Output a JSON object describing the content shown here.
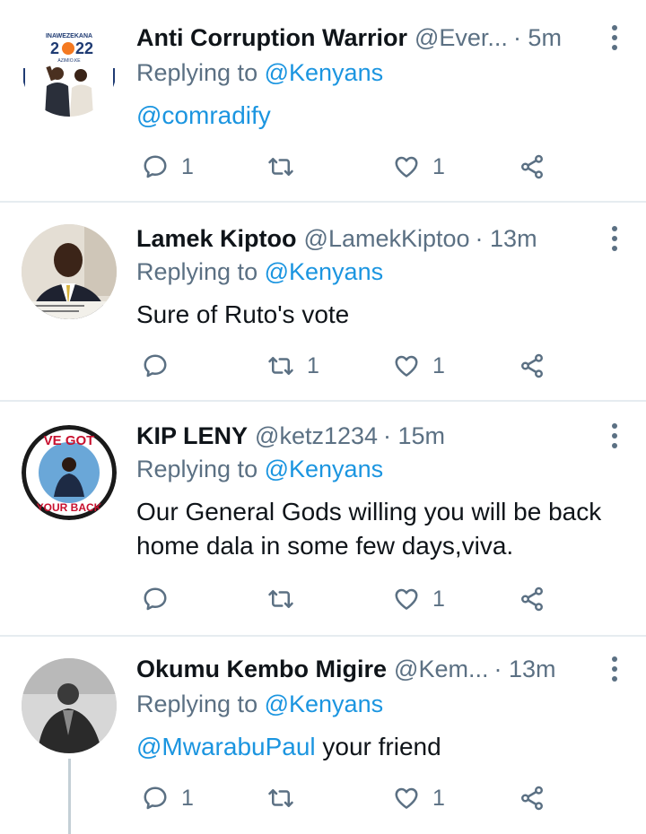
{
  "tweets": [
    {
      "name": "Anti Corruption Warrior",
      "handle": "@Ever...",
      "time": "· 5m",
      "replying_label": "Replying to",
      "replying_to": "@Kenyans",
      "mention": "@comradify",
      "text": "",
      "replies": "1",
      "retweets": "",
      "likes": "1",
      "avatar": {
        "top_text": "INAWEZEKANA",
        "year_a": "2",
        "year_b": "22",
        "bottom_text": "AZIMIO.KE"
      }
    },
    {
      "name": "Lamek Kiptoo",
      "handle": "@LamekKiptoo",
      "time": "· 13m",
      "replying_label": "Replying to",
      "replying_to": "@Kenyans",
      "mention": "",
      "text": "Sure of Ruto's vote",
      "replies": "",
      "retweets": "1",
      "likes": "1"
    },
    {
      "name": "KIP LENY",
      "handle": "@ketz1234",
      "time": "· 15m",
      "replying_label": "Replying to",
      "replying_to": "@Kenyans",
      "mention": "",
      "text": "Our General Gods willing you will be back home dala in some few days,viva.",
      "replies": "",
      "retweets": "",
      "likes": "1",
      "avatar": {
        "top_text": "VE GOT",
        "bottom_text": "YOUR BACK"
      }
    },
    {
      "name": "Okumu Kembo Migire",
      "handle": "@Kem...",
      "time": "· 13m",
      "replying_label": "Replying to",
      "replying_to": "@Kenyans",
      "mention": "@MwarabuPaul",
      "text": " your friend",
      "replies": "1",
      "retweets": "",
      "likes": "1"
    }
  ],
  "colors": {
    "link": "#1b95e0",
    "secondary": "#5b7083",
    "divider": "#e6ecf0"
  },
  "icons": [
    "reply-icon",
    "retweet-icon",
    "like-icon",
    "share-icon",
    "more-icon"
  ]
}
